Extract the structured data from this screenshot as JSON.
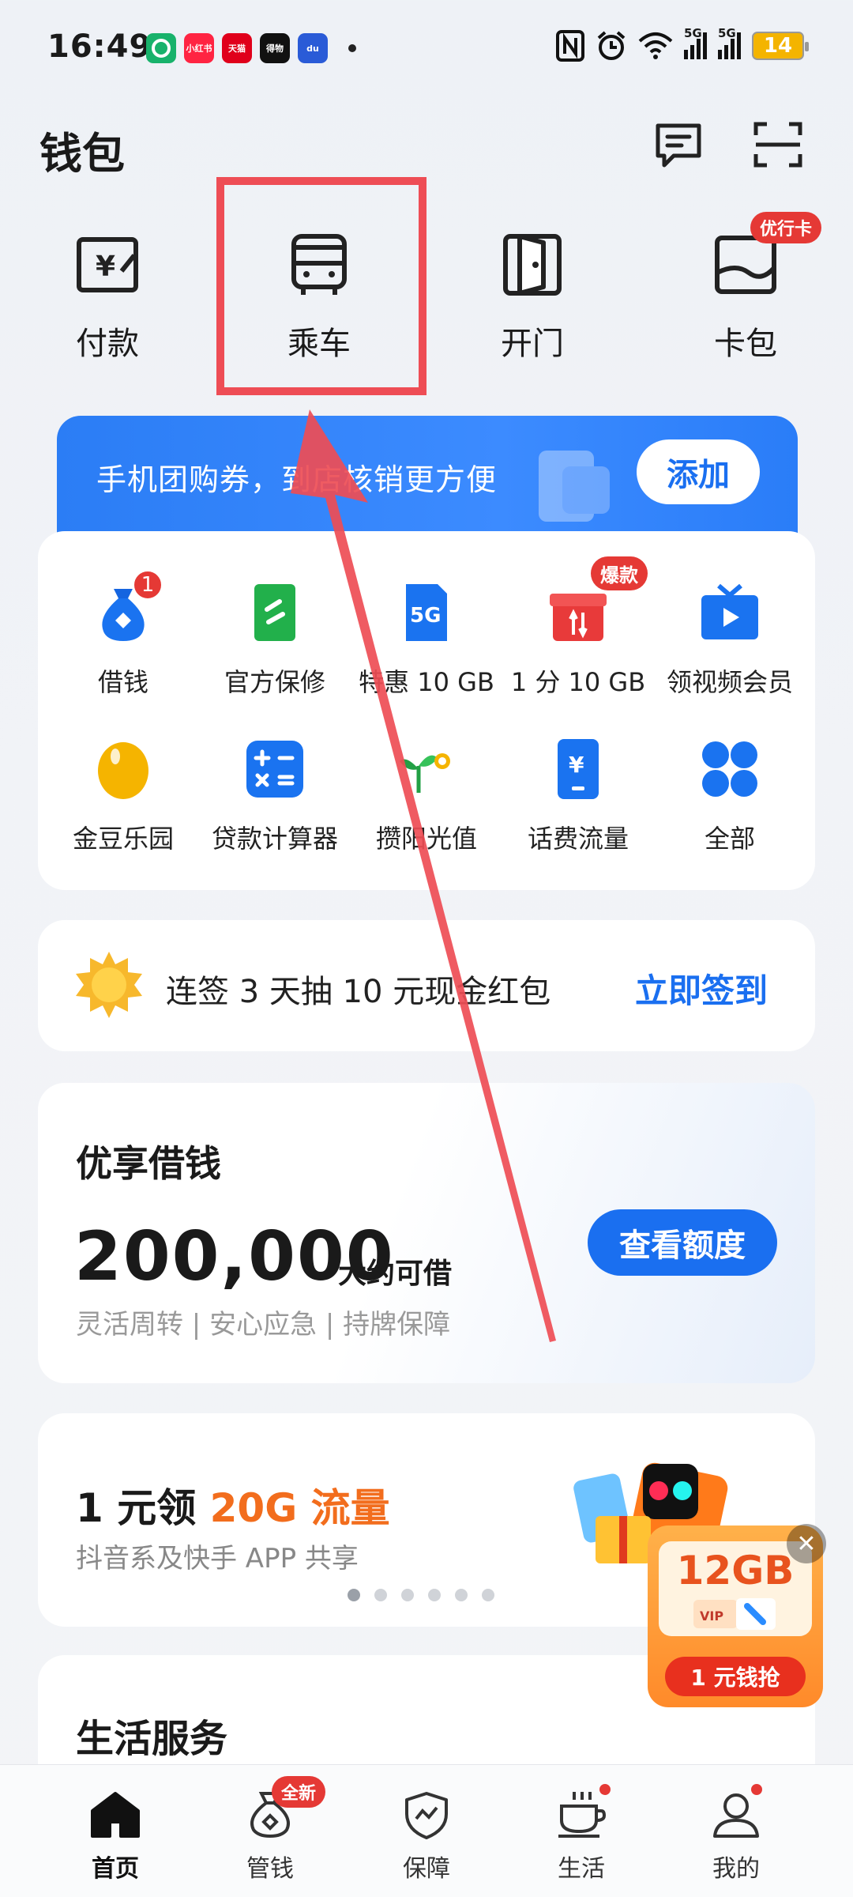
{
  "status_bar": {
    "time": "16:49",
    "apps": [
      {
        "name": "app-1",
        "label": "",
        "color": "#18b26b"
      },
      {
        "name": "app-2",
        "label": "小红书",
        "color": "#ff2442"
      },
      {
        "name": "app-3",
        "label": "天猫",
        "color": "#e0001b"
      },
      {
        "name": "app-4",
        "label": "得物",
        "color": "#111111"
      },
      {
        "name": "app-5",
        "label": "du",
        "color": "#2a5bd7"
      }
    ],
    "signal_1": "5G",
    "signal_2": "5G",
    "battery": "14"
  },
  "header": {
    "title": "钱包"
  },
  "quick_actions": [
    {
      "label": "付款",
      "icon": "yuan-card-icon"
    },
    {
      "label": "乘车",
      "icon": "bus-icon"
    },
    {
      "label": "开门",
      "icon": "door-icon"
    },
    {
      "label": "卡包",
      "icon": "card-wallet-icon",
      "badge": "优行卡"
    }
  ],
  "promo_banner": {
    "text": "手机团购券，到店核销更方便",
    "button": "添加"
  },
  "services": [
    {
      "label": "借钱",
      "badge": "1"
    },
    {
      "label": "官方保修"
    },
    {
      "label": "特惠 10 GB"
    },
    {
      "label": "1 分 10 GB",
      "badge": "爆款"
    },
    {
      "label": "领视频会员"
    },
    {
      "label": "金豆乐园"
    },
    {
      "label": "贷款计算器"
    },
    {
      "label": "攒阳光值"
    },
    {
      "label": "话费流量"
    },
    {
      "label": "全部"
    }
  ],
  "signin": {
    "text": "连签 3 天抽 10 元现金红包",
    "action": "立即签到"
  },
  "loan": {
    "title": "优享借钱",
    "amount": "200,000",
    "unit": "大约可借",
    "tags": "灵活周转 | 安心应急 | 持牌保障",
    "button": "查看额度"
  },
  "data_offer": {
    "title_prefix": "1 元领 ",
    "title_highlight": "20G 流量",
    "subtitle": "抖音系及快手 APP 共享",
    "page_count": 6,
    "active_page": 0
  },
  "floating_ad": {
    "size": "12GB",
    "button": "1 元钱抢",
    "close": "✕"
  },
  "life_service": {
    "title": "生活服务"
  },
  "bottom_nav": [
    {
      "label": "首页",
      "active": true
    },
    {
      "label": "管钱",
      "badge": "全新"
    },
    {
      "label": "保障"
    },
    {
      "label": "生活",
      "dot": true
    },
    {
      "label": "我的",
      "dot": true
    }
  ],
  "colors": {
    "accent": "#1a6ff0",
    "annotation": "#ee4d55",
    "highlight_orange": "#f26d1d"
  }
}
